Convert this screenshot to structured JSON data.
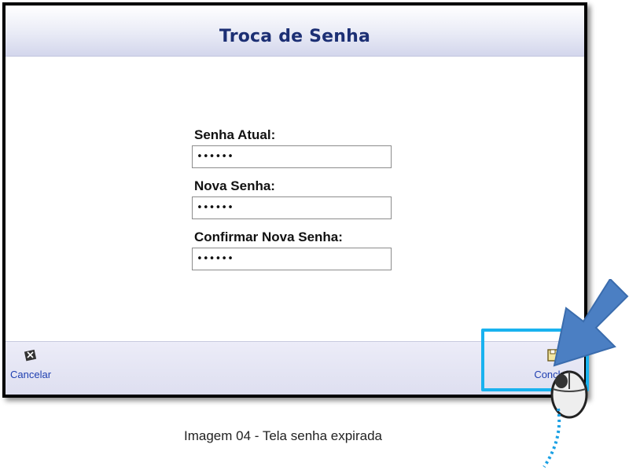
{
  "dialog": {
    "title": "Troca de Senha",
    "fields": [
      {
        "label": "Senha Atual:",
        "value": "••••••"
      },
      {
        "label": "Nova Senha:",
        "value": "••••••"
      },
      {
        "label": "Confirmar Nova Senha:",
        "value": "••••••"
      }
    ],
    "footer": {
      "cancel_label": "Cancelar",
      "cancel_icon": "cancel-icon",
      "conclude_label": "Concluir",
      "conclude_icon": "save-icon"
    }
  },
  "annotation": {
    "caption": "Imagem 04 - Tela senha expirada",
    "highlight_color": "#19b2ef",
    "arrow_color": "#4b7fc3"
  }
}
